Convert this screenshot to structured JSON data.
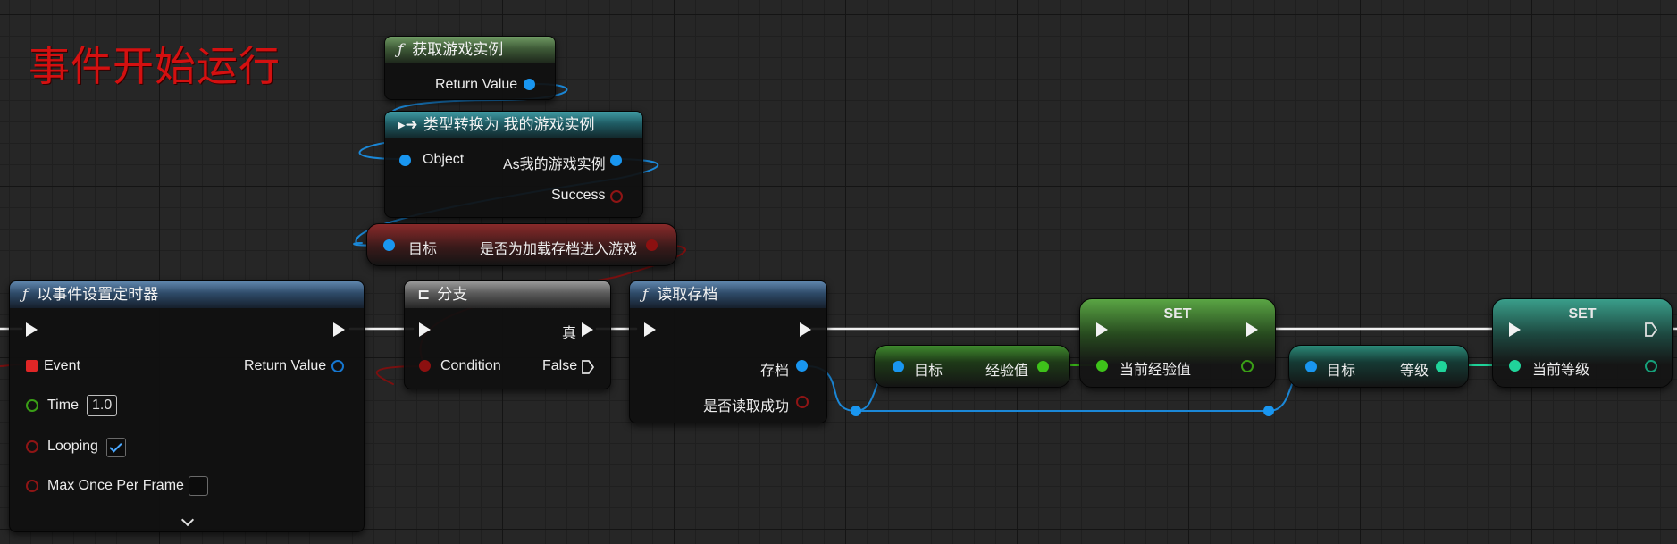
{
  "comment": "事件开始运行",
  "colors": {
    "exec": "#ffffff",
    "object_pin": "#1996f0",
    "bool_pin": "#8c1010",
    "int_pin_green": "#3ec21a",
    "int_pin_teal": "#20d49a",
    "comment_text": "#d41010"
  },
  "get_game_instance": {
    "title": "获取游戏实例",
    "return_value": "Return Value"
  },
  "cast_node": {
    "title": "类型转换为 我的游戏实例",
    "object": "Object",
    "as_output": "As我的游戏实例",
    "success": "Success"
  },
  "bool_getter": {
    "target": "目标",
    "output": "是否为加载存档进入游戏"
  },
  "set_timer": {
    "title": "以事件设置定时器",
    "event": "Event",
    "return_value": "Return Value",
    "time_label": "Time",
    "time_value": "1.0",
    "looping": "Looping",
    "looping_checked": true,
    "max_once": "Max Once Per Frame",
    "max_once_checked": false
  },
  "branch": {
    "title": "分支",
    "condition": "Condition",
    "true_label": "真",
    "false_label": "False"
  },
  "load_save": {
    "title": "读取存档",
    "save": "存档",
    "success": "是否读取成功"
  },
  "get_exp": {
    "target": "目标",
    "output": "经验值"
  },
  "set_exp": {
    "title": "SET",
    "input": "当前经验值"
  },
  "get_level": {
    "target": "目标",
    "output": "等级"
  },
  "set_level": {
    "title": "SET",
    "input": "当前等级"
  }
}
